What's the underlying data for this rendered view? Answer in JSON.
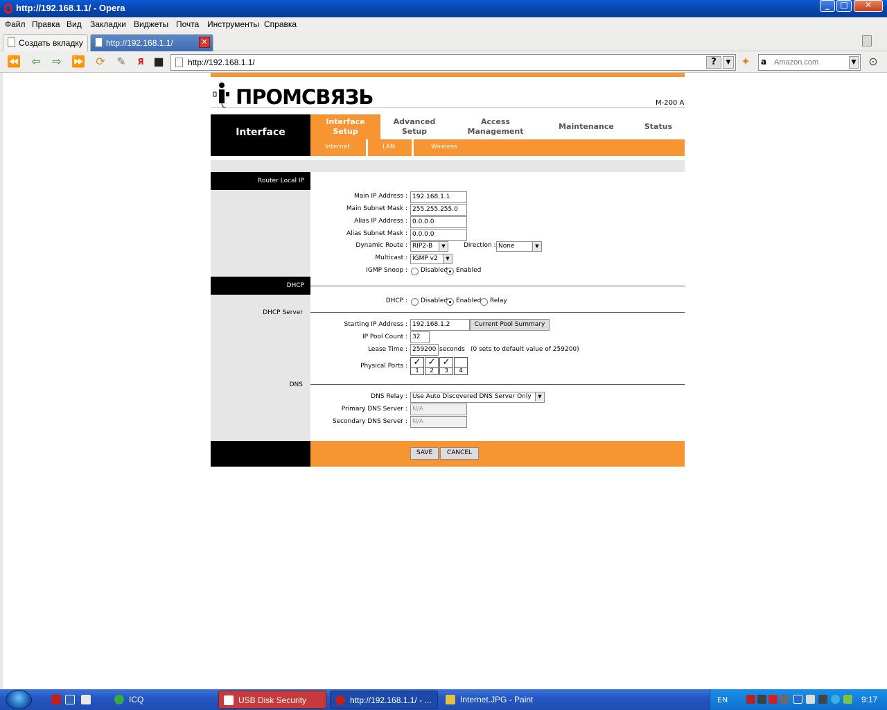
{
  "window": {
    "title": "http://192.168.1.1/ - Opera"
  },
  "menu": [
    "Файл",
    "Правка",
    "Вид",
    "Закладки",
    "Виджеты",
    "Почта",
    "Инструменты",
    "Справка"
  ],
  "tabs": {
    "new_tab": "Создать вкладку",
    "active_tab": "http://192.168.1.1/"
  },
  "address": {
    "url": "http://192.168.1.1/",
    "help": "?"
  },
  "search": {
    "placeholder": "Amazon.com",
    "provider_icon": "a"
  },
  "router": {
    "brand": "ПРОМСВЯЗЬ",
    "model": "M-200 A",
    "section_title": "Interface",
    "nav": [
      {
        "line1": "Interface",
        "line2": "Setup",
        "active": true
      },
      {
        "line1": "Advanced",
        "line2": "Setup"
      },
      {
        "line1": "Access",
        "line2": "Management"
      },
      {
        "line1": "Maintenance",
        "line2": ""
      },
      {
        "line1": "Status",
        "line2": ""
      }
    ],
    "subnav": [
      "Internet",
      "LAN",
      "Wireless"
    ],
    "headers": {
      "router_local_ip": "Router Local IP",
      "dhcp": "DHCP"
    },
    "sublabels": {
      "dhcp_server": "DHCP Server",
      "dns": "DNS"
    },
    "lan": {
      "main_ip_label": "Main IP Address :",
      "main_ip": "192.168.1.1",
      "main_mask_label": "Main Subnet Mask :",
      "main_mask": "255.255.255.0",
      "alias_ip_label": "Alias IP Address :",
      "alias_ip": "0.0.0.0",
      "alias_mask_label": "Alias Subnet Mask :",
      "alias_mask": "0.0.0.0",
      "dyn_route_label": "Dynamic Route :",
      "dyn_route": "RIP2-B",
      "direction_label": "Direction :",
      "direction": "None",
      "multicast_label": "Multicast :",
      "multicast": "IGMP v2",
      "igmp_snoop_label": "IGMP Snoop :",
      "igmp_disabled": "Disabled",
      "igmp_enabled": "Enabled"
    },
    "dhcp": {
      "label": "DHCP :",
      "disabled": "Disabled",
      "enabled": "Enabled",
      "relay": "Relay",
      "start_ip_label": "Starting IP Address :",
      "start_ip": "192.168.1.2",
      "pool_button": "Current Pool Summary",
      "pool_count_label": "IP Pool Count :",
      "pool_count": "32",
      "lease_label": "Lease Time :",
      "lease": "259200",
      "lease_unit": "seconds",
      "lease_note": "(0 sets to default value of 259200)",
      "ports_label": "Physical Ports :",
      "ports": [
        {
          "num": "1",
          "checked": true
        },
        {
          "num": "2",
          "checked": true
        },
        {
          "num": "3",
          "checked": true
        },
        {
          "num": "4",
          "checked": false
        }
      ]
    },
    "dns": {
      "relay_label": "DNS Relay :",
      "relay": "Use Auto Discovered DNS Server Only",
      "primary_label": "Primary DNS Server :",
      "primary": "N/A",
      "secondary_label": "Secondary DNS Server :",
      "secondary": "N/A"
    },
    "buttons": {
      "save": "SAVE",
      "cancel": "CANCEL"
    }
  },
  "taskbar": {
    "tasks": [
      "ICQ",
      "USB Disk Security",
      "http://192.168.1.1/ - ...",
      "Internet.JPG - Paint"
    ],
    "lang": "EN",
    "clock": "9:17"
  }
}
